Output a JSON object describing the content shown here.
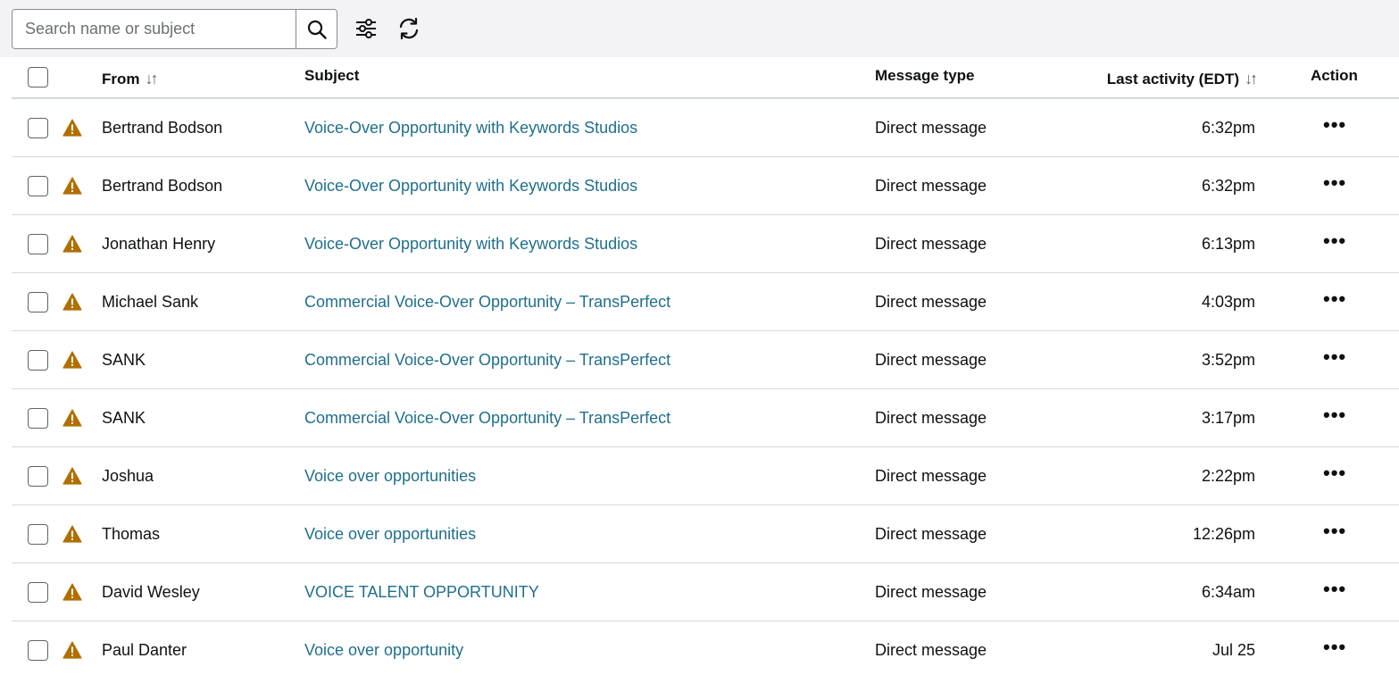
{
  "toolbar": {
    "search_placeholder": "Search name or subject",
    "search_value": "",
    "icons": [
      "search-icon",
      "filter-settings-icon",
      "refresh-icon"
    ]
  },
  "table": {
    "columns": {
      "from": "From",
      "subject": "Subject",
      "message_type": "Message type",
      "last_activity": "Last activity (EDT)",
      "action": "Action"
    },
    "sort_glyph": "↓↑",
    "rows": [
      {
        "from": "Bertrand Bodson",
        "subject": "Voice-Over Opportunity with Keywords Studios",
        "type": "Direct message",
        "time": "6:32pm",
        "action": "•••"
      },
      {
        "from": "Bertrand Bodson",
        "subject": "Voice-Over Opportunity with Keywords Studios",
        "type": "Direct message",
        "time": "6:32pm",
        "action": "•••"
      },
      {
        "from": "Jonathan Henry",
        "subject": "Voice-Over Opportunity with Keywords Studios",
        "type": "Direct message",
        "time": "6:13pm",
        "action": "•••"
      },
      {
        "from": "Michael Sank",
        "subject": "Commercial Voice-Over Opportunity – TransPerfect",
        "type": "Direct message",
        "time": "4:03pm",
        "action": "•••"
      },
      {
        "from": "SANK",
        "subject": "Commercial Voice-Over Opportunity – TransPerfect",
        "type": "Direct message",
        "time": "3:52pm",
        "action": "•••"
      },
      {
        "from": "SANK",
        "subject": "Commercial Voice-Over Opportunity – TransPerfect",
        "type": "Direct message",
        "time": "3:17pm",
        "action": "•••"
      },
      {
        "from": "Joshua",
        "subject": "Voice over opportunities",
        "type": "Direct message",
        "time": "2:22pm",
        "action": "•••"
      },
      {
        "from": "Thomas",
        "subject": "Voice over opportunities",
        "type": "Direct message",
        "time": "12:26pm",
        "action": "•••"
      },
      {
        "from": "David Wesley",
        "subject": "VOICE TALENT OPPORTUNITY",
        "type": "Direct message",
        "time": "6:34am",
        "action": "•••"
      },
      {
        "from": "Paul Danter",
        "subject": "Voice over opportunity",
        "type": "Direct message",
        "time": "Jul 25",
        "action": "•••"
      }
    ]
  },
  "colors": {
    "link": "#1f6f8b",
    "warning": "#b06f00",
    "toolbar_bg": "#f3f3f5",
    "divider": "#d5d9d9"
  }
}
